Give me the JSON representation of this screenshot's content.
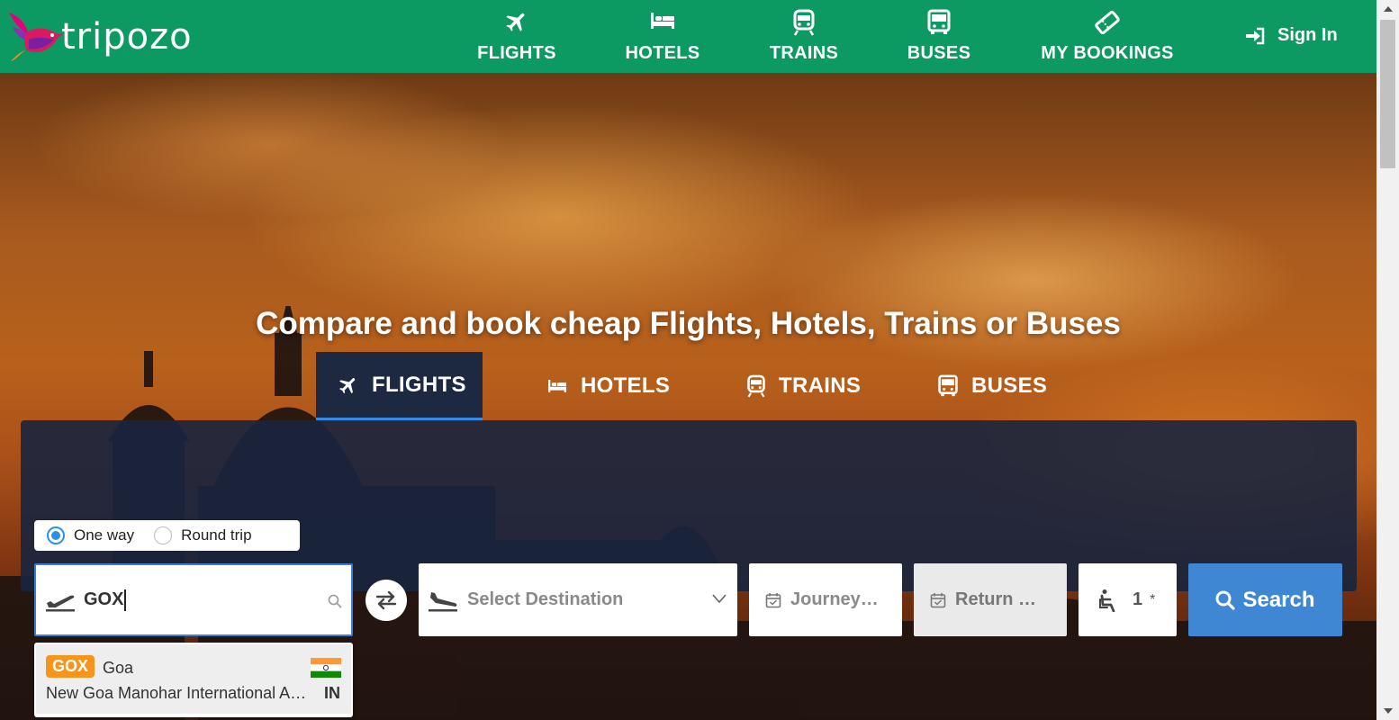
{
  "brand": {
    "name": "tripozo"
  },
  "nav": {
    "items": [
      {
        "label": "FLIGHTS",
        "icon": "plane-icon"
      },
      {
        "label": "HOTELS",
        "icon": "bed-icon"
      },
      {
        "label": "TRAINS",
        "icon": "train-icon"
      },
      {
        "label": "BUSES",
        "icon": "bus-icon"
      },
      {
        "label": "MY BOOKINGS",
        "icon": "ticket-icon"
      }
    ],
    "signin_label": "Sign In"
  },
  "hero": {
    "tagline": "Compare and book cheap Flights, Hotels, Trains or Buses"
  },
  "tabs": [
    {
      "label": "FLIGHTS",
      "icon": "plane-icon",
      "active": true
    },
    {
      "label": "HOTELS",
      "icon": "bed-icon",
      "active": false
    },
    {
      "label": "TRAINS",
      "icon": "train-icon",
      "active": false
    },
    {
      "label": "BUSES",
      "icon": "bus-icon",
      "active": false
    }
  ],
  "search": {
    "trip_types": [
      {
        "label": "One way",
        "selected": true
      },
      {
        "label": "Round trip",
        "selected": false
      }
    ],
    "source": {
      "value": "GOX"
    },
    "destination": {
      "placeholder": "Select Destination"
    },
    "journey_date": {
      "placeholder": "Journey…"
    },
    "return_date": {
      "placeholder": "Return …"
    },
    "passengers": {
      "value": "1",
      "required_mark": "*"
    },
    "button_label": "Search"
  },
  "suggestions": [
    {
      "code": "GOX",
      "city": "Goa",
      "airport": "New Goa Manohar International Airport",
      "country": "IN",
      "flag": "india-flag-icon"
    }
  ],
  "colors": {
    "header": "#0c9a62",
    "panel": "#18253e",
    "accent": "#2f8fe6",
    "search_button": "#3f86d3",
    "code_badge": "#f7941d"
  }
}
